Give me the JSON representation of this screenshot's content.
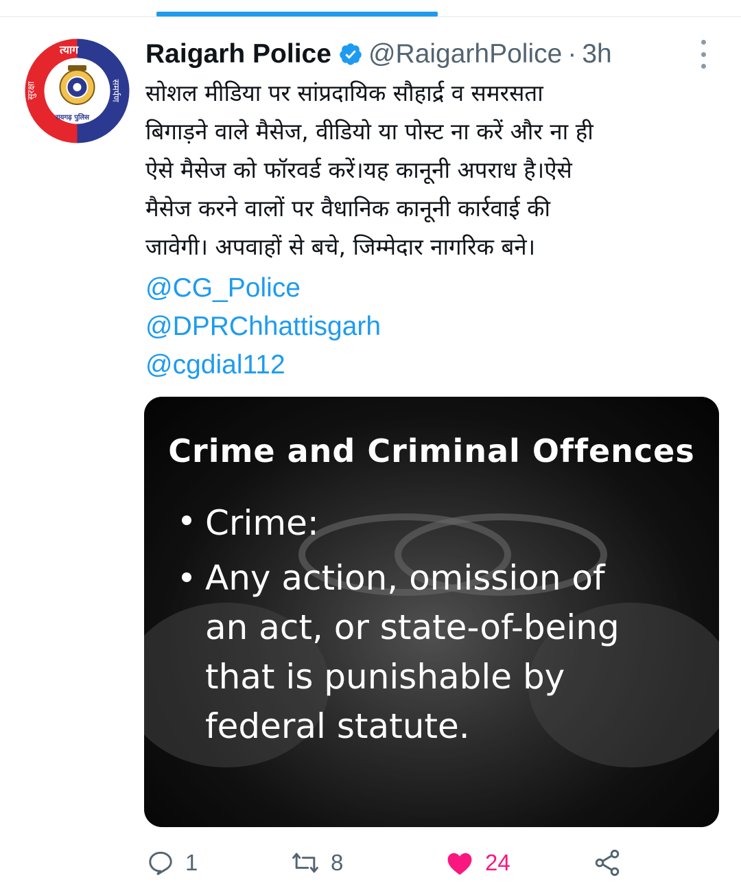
{
  "tweet": {
    "display_name": "Raigarh Police",
    "handle": "@RaigarhPolice",
    "separator": "·",
    "time": "3h",
    "text_lines": [
      "सोशल मीडिया पर सांप्रदायिक सौहार्द्र व समरसता",
      "बिगाड़ने वाले मैसेज, वीडियो या पोस्ट ना करें और ना ही",
      "ऐसे मैसेज को फॉरवर्ड करें।यह कानूनी अपराध है।ऐसे",
      "मैसेज करने वालों पर वैधानिक कानूनी कार्रवाई की",
      "जावेगी। अपवाहों से बचे, जिम्मेदार नागरिक बने।"
    ],
    "mentions": [
      "@CG_Police",
      "@DPRChhattisgarh",
      "@cgdial112"
    ],
    "avatar": {
      "top_text": "त्याग",
      "left_text": "सुरक्षा",
      "right_text": "समर्पण",
      "bottom_text": "रायगढ़ पुलिस",
      "colors": {
        "red": "#e5262c",
        "blue": "#2b3990"
      }
    },
    "media": {
      "title": "Crime and Criminal Offences",
      "bullets": [
        "Crime:",
        "Any action, omission of an act, or state-of-being that is punishable by federal statute."
      ]
    },
    "actions": {
      "replies": "1",
      "retweets": "8",
      "likes": "24"
    }
  },
  "colors": {
    "accent": "#1d9bf0",
    "like": "#f91880",
    "muted": "#536471"
  },
  "icons": [
    "verified-badge-icon",
    "more-options-icon",
    "reply-icon",
    "retweet-icon",
    "like-icon",
    "share-icon"
  ]
}
